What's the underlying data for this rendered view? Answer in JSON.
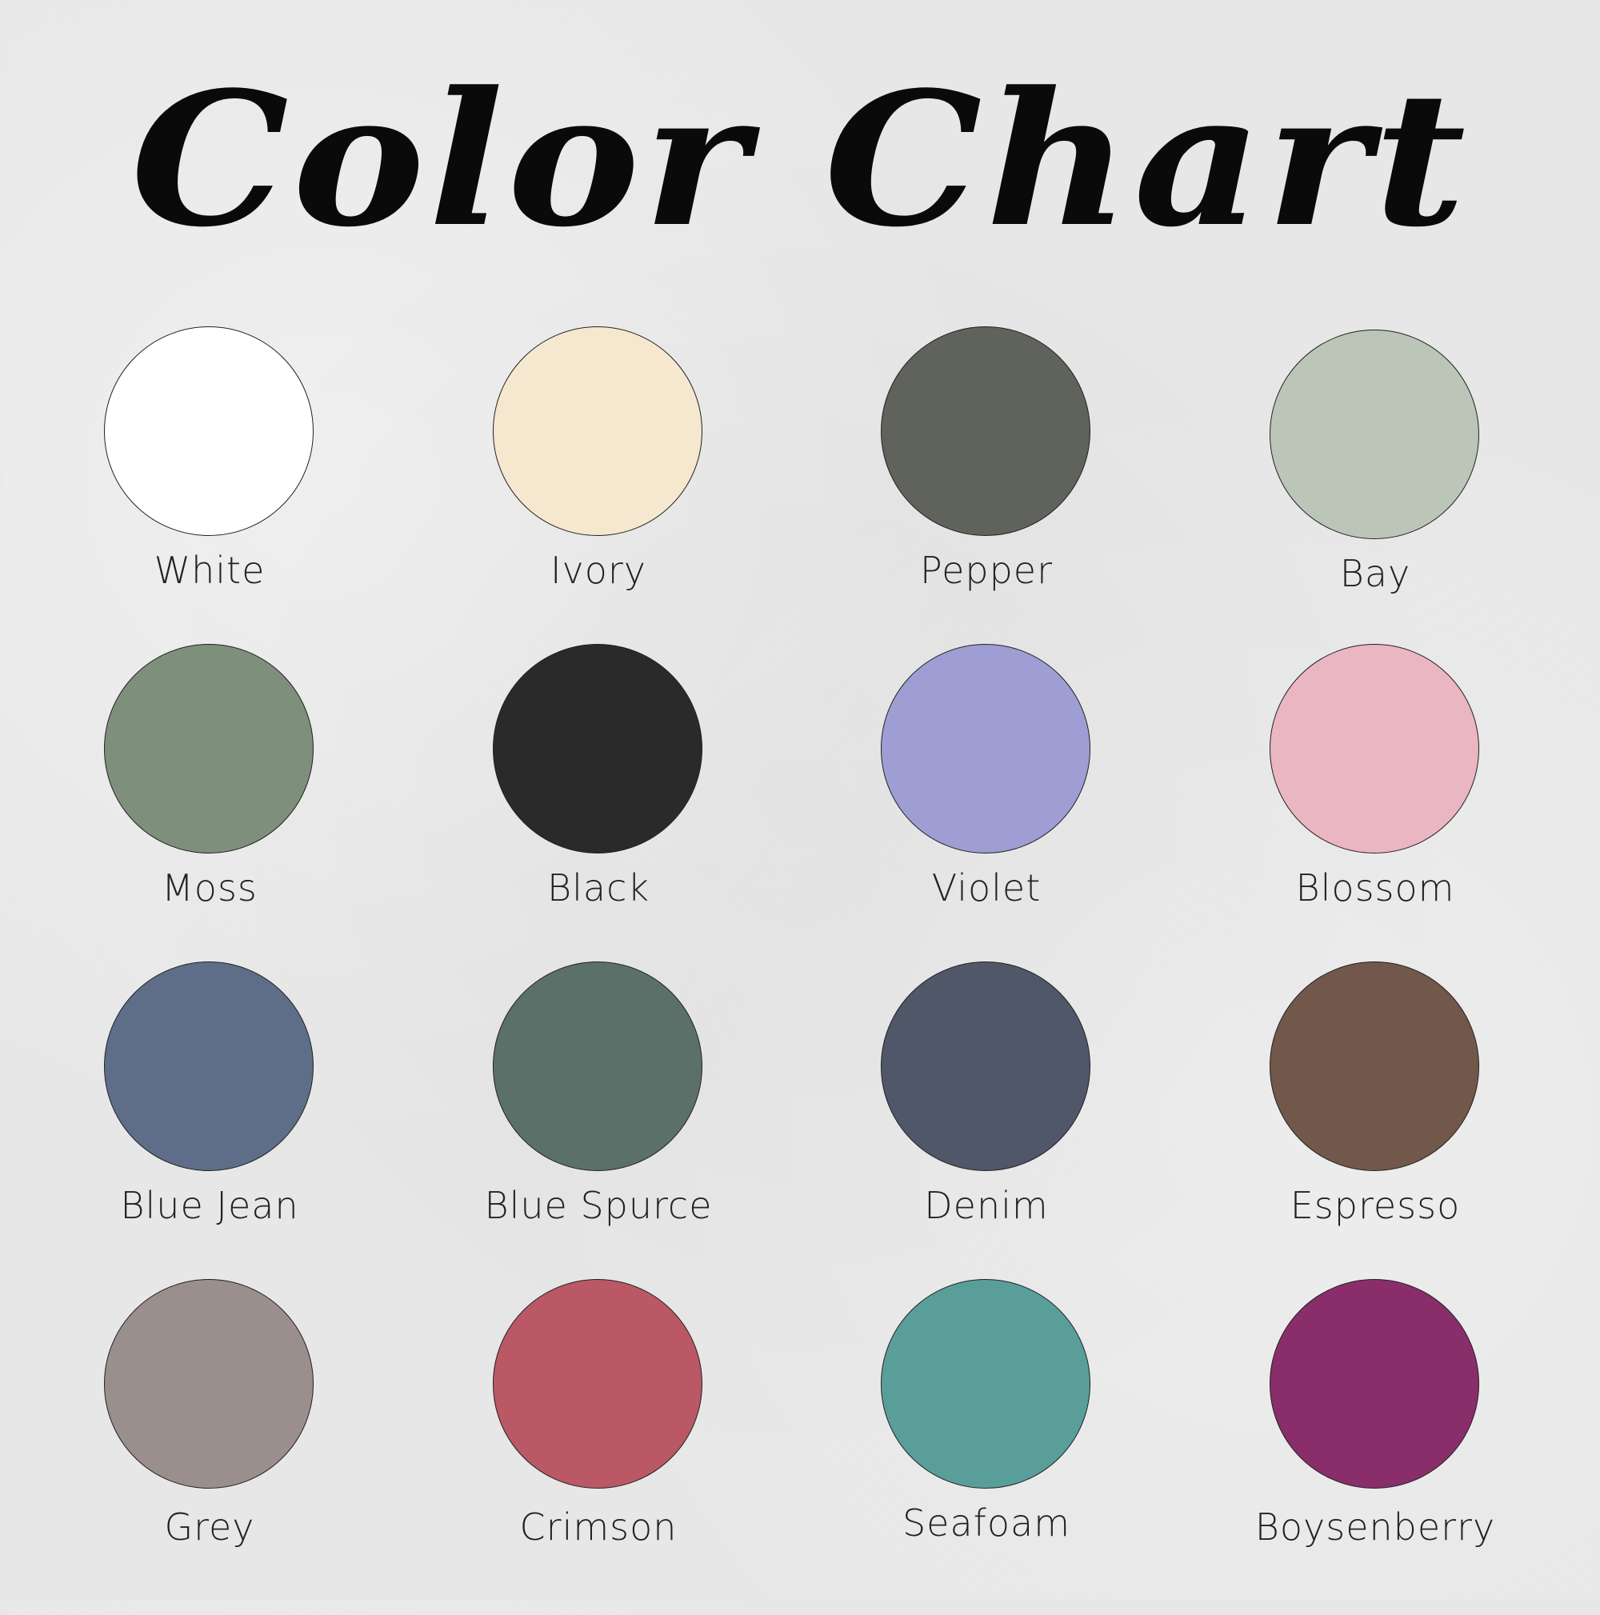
{
  "title": "Color Chart",
  "swatches": [
    {
      "name": "White",
      "color": "#ffffff"
    },
    {
      "name": "Ivory",
      "color": "#f6e8cf"
    },
    {
      "name": "Pepper",
      "color": "#60625c"
    },
    {
      "name": "Bay",
      "color": "#bbc5b8"
    },
    {
      "name": "Moss",
      "color": "#7e8f7b"
    },
    {
      "name": "Black",
      "color": "#2a2a2a"
    },
    {
      "name": "Violet",
      "color": "#9e9ed4"
    },
    {
      "name": "Blossom",
      "color": "#eab6c2"
    },
    {
      "name": "Blue Jean",
      "color": "#5e6e88"
    },
    {
      "name": "Blue Spurce",
      "color": "#5b7068"
    },
    {
      "name": "Denim",
      "color": "#4f5768"
    },
    {
      "name": "Espresso",
      "color": "#72584a"
    },
    {
      "name": "Grey",
      "color": "#9a8f8c"
    },
    {
      "name": "Crimson",
      "color": "#ba5865"
    },
    {
      "name": "Seafoam",
      "color": "#5a9e99"
    },
    {
      "name": "Boysenberry",
      "color": "#892e6a"
    }
  ]
}
